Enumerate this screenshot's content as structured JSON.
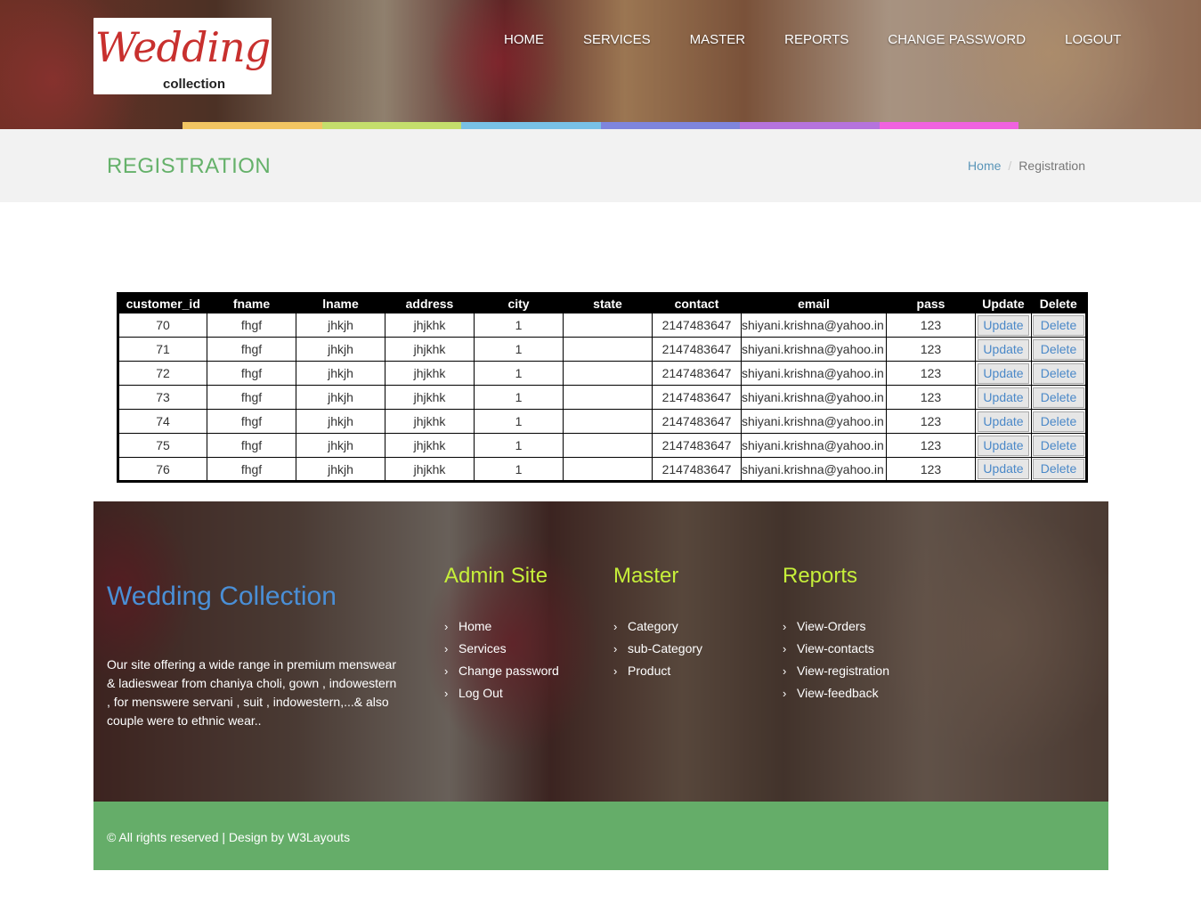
{
  "header": {
    "logo_text": "Wedding",
    "logo_sub": "collection",
    "nav": [
      "HOME",
      "SERVICES",
      "MASTER",
      "REPORTS",
      "CHANGE PASSWORD",
      "LOGOUT"
    ],
    "colorbar": [
      "#f2c562",
      "#c4de6c",
      "#78c1e6",
      "#7e85dd",
      "#b573dd",
      "#f062e0"
    ]
  },
  "title_band": {
    "title": "REGISTRATION",
    "breadcrumb_home": "Home",
    "breadcrumb_sep": "/",
    "breadcrumb_current": "Registration"
  },
  "table": {
    "columns": [
      "customer_id",
      "fname",
      "lname",
      "address",
      "city",
      "state",
      "contact",
      "email",
      "pass",
      "Update",
      "Delete"
    ],
    "update_label": "Update",
    "delete_label": "Delete",
    "rows": [
      {
        "customer_id": "70",
        "fname": "fhgf",
        "lname": "jhkjh",
        "address": "jhjkhk",
        "city": "1",
        "state": "",
        "contact": "2147483647",
        "email": "shiyani.krishna@yahoo.in",
        "pass": "123"
      },
      {
        "customer_id": "71",
        "fname": "fhgf",
        "lname": "jhkjh",
        "address": "jhjkhk",
        "city": "1",
        "state": "",
        "contact": "2147483647",
        "email": "shiyani.krishna@yahoo.in",
        "pass": "123"
      },
      {
        "customer_id": "72",
        "fname": "fhgf",
        "lname": "jhkjh",
        "address": "jhjkhk",
        "city": "1",
        "state": "",
        "contact": "2147483647",
        "email": "shiyani.krishna@yahoo.in",
        "pass": "123"
      },
      {
        "customer_id": "73",
        "fname": "fhgf",
        "lname": "jhkjh",
        "address": "jhjkhk",
        "city": "1",
        "state": "",
        "contact": "2147483647",
        "email": "shiyani.krishna@yahoo.in",
        "pass": "123"
      },
      {
        "customer_id": "74",
        "fname": "fhgf",
        "lname": "jhkjh",
        "address": "jhjkhk",
        "city": "1",
        "state": "",
        "contact": "2147483647",
        "email": "shiyani.krishna@yahoo.in",
        "pass": "123"
      },
      {
        "customer_id": "75",
        "fname": "fhgf",
        "lname": "jhkjh",
        "address": "jhjkhk",
        "city": "1",
        "state": "",
        "contact": "2147483647",
        "email": "shiyani.krishna@yahoo.in",
        "pass": "123"
      },
      {
        "customer_id": "76",
        "fname": "fhgf",
        "lname": "jhkjh",
        "address": "jhjkhk",
        "city": "1",
        "state": "",
        "contact": "2147483647",
        "email": "shiyani.krishna@yahoo.in",
        "pass": "123"
      }
    ]
  },
  "footer": {
    "brand": "Wedding Collection",
    "description": "Our site offering a wide range in premium menswear & ladieswear from chaniya choli, gown , indowestern , for menswere servani , suit , indowestern,...& also couple were to ethnic wear..",
    "columns": [
      {
        "title": "Admin Site",
        "links": [
          "Home",
          "Services",
          "Change password",
          "Log Out"
        ]
      },
      {
        "title": "Master",
        "links": [
          "Category",
          "sub-Category",
          "Product"
        ]
      },
      {
        "title": "Reports",
        "links": [
          "View-Orders",
          "View-contacts",
          "View-registration",
          "View-feedback"
        ]
      }
    ],
    "bullet_icon": "chevron-right-icon",
    "copyright": "© All rights reserved | Design by W3Layouts"
  },
  "colors": {
    "accent_green": "#65b16a",
    "footer_heading": "#c6ef3a",
    "brand_blue": "#4a8fd6",
    "link_blue": "#4a88c8"
  }
}
